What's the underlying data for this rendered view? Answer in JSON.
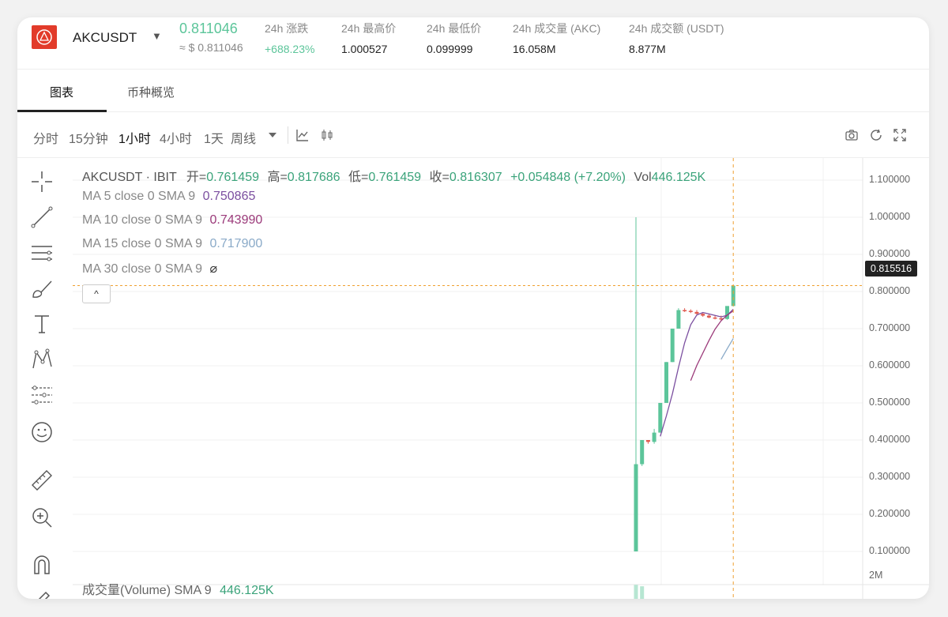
{
  "header": {
    "symbol": "AKCUSDT",
    "price": "0.811046",
    "price_usd": "≈ $ 0.811046",
    "stats": [
      {
        "label": "24h 涨跌",
        "value": "+688.23%",
        "color": "#5cc59a"
      },
      {
        "label": "24h 最高价",
        "value": "1.000527"
      },
      {
        "label": "24h 最低价",
        "value": "0.099999"
      },
      {
        "label": "24h 成交量 (AKC)",
        "value": "16.058M"
      },
      {
        "label": "24h 成交额 (USDT)",
        "value": "8.877M"
      }
    ]
  },
  "tabs": [
    {
      "label": "图表",
      "active": true
    },
    {
      "label": "币种概览",
      "active": false
    }
  ],
  "toolbar": {
    "timeframes": [
      "分时",
      "15分钟",
      "1小时",
      "4小时",
      "1天",
      "周线"
    ],
    "active_timeframe": "1小时",
    "icons": [
      "chevron-down-icon",
      "line-chart-icon",
      "candles-icon",
      "camera-icon",
      "refresh-icon",
      "fullscreen-icon"
    ]
  },
  "tools": [
    "crosshair-icon",
    "trend-line-icon",
    "fib-lines-icon",
    "brush-icon",
    "text-icon",
    "pattern-icon",
    "forecast-icon",
    "emoji-icon",
    "ruler-icon",
    "zoom-in-icon",
    "magnet-icon",
    "pencil-icon"
  ],
  "legend": {
    "name": "AKCUSDT · IBIT",
    "open_label": "开=",
    "open": "0.761459",
    "high_label": "高=",
    "high": "0.817686",
    "low_label": "低=",
    "low": "0.761459",
    "close_label": "收=",
    "close": "0.816307",
    "change": "+0.054848 (+7.20%)",
    "vol_label": "Vol",
    "vol": "446.125K"
  },
  "ma": [
    {
      "label": "MA 5 close 0 SMA 9",
      "value": "0.750865",
      "color": "#7b4fa0"
    },
    {
      "label": "MA 10 close 0 SMA 9",
      "value": "0.743990",
      "color": "#9b3a7a"
    },
    {
      "label": "MA 15 close 0 SMA 9",
      "value": "0.717900",
      "color": "#8aaac8"
    },
    {
      "label": "MA 30 close 0 SMA 9",
      "value": "⌀",
      "color": "#333333"
    }
  ],
  "collapse_label": "^",
  "current_price_tag": "0.815516",
  "volume_legend": {
    "label": "成交量(Volume) SMA 9",
    "value": "446.125K"
  },
  "chart_data": {
    "type": "candlestick",
    "ylim": [
      0.1,
      1.1
    ],
    "yticks": [
      "1.100000",
      "1.000000",
      "0.900000",
      "0.800000",
      "0.700000",
      "0.600000",
      "0.500000",
      "0.400000",
      "0.300000",
      "0.200000",
      "0.100000"
    ],
    "volume_tick": "2M",
    "up_color": "#5cc59a",
    "down_color": "#e05a4f",
    "candles": [
      {
        "o": 0.1,
        "h": 1.0,
        "l": 0.1,
        "c": 0.335
      },
      {
        "o": 0.335,
        "h": 0.4,
        "l": 0.33,
        "c": 0.4
      },
      {
        "o": 0.4,
        "h": 0.4,
        "l": 0.39,
        "c": 0.395
      },
      {
        "o": 0.395,
        "h": 0.43,
        "l": 0.39,
        "c": 0.42
      },
      {
        "o": 0.42,
        "h": 0.5,
        "l": 0.42,
        "c": 0.5
      },
      {
        "o": 0.5,
        "h": 0.61,
        "l": 0.5,
        "c": 0.61
      },
      {
        "o": 0.61,
        "h": 0.7,
        "l": 0.61,
        "c": 0.7
      },
      {
        "o": 0.7,
        "h": 0.755,
        "l": 0.7,
        "c": 0.75
      },
      {
        "o": 0.75,
        "h": 0.755,
        "l": 0.745,
        "c": 0.748
      },
      {
        "o": 0.748,
        "h": 0.752,
        "l": 0.742,
        "c": 0.745
      },
      {
        "o": 0.745,
        "h": 0.75,
        "l": 0.738,
        "c": 0.74
      },
      {
        "o": 0.74,
        "h": 0.744,
        "l": 0.732,
        "c": 0.735
      },
      {
        "o": 0.735,
        "h": 0.74,
        "l": 0.728,
        "c": 0.73
      },
      {
        "o": 0.73,
        "h": 0.735,
        "l": 0.725,
        "c": 0.728
      },
      {
        "o": 0.728,
        "h": 0.735,
        "l": 0.722,
        "c": 0.726
      },
      {
        "o": 0.726,
        "h": 0.76,
        "l": 0.724,
        "c": 0.761
      },
      {
        "o": 0.761,
        "h": 0.818,
        "l": 0.761,
        "c": 0.816
      }
    ],
    "volume": [
      1.3,
      1.1
    ]
  }
}
